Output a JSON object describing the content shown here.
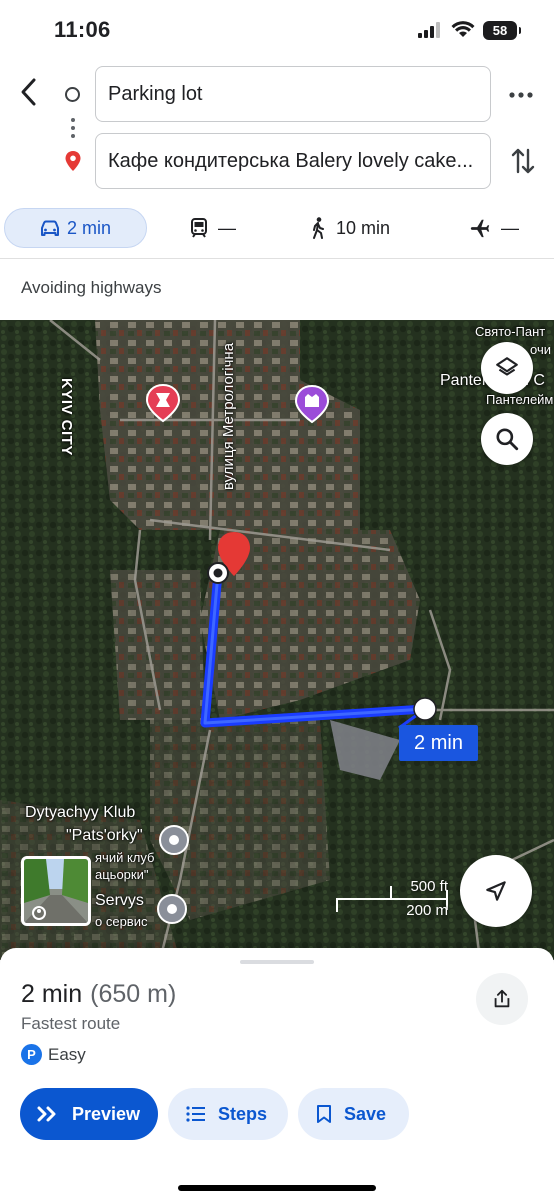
{
  "status_bar": {
    "time": "11:06",
    "battery": "58"
  },
  "directions": {
    "origin": "Parking lot",
    "destination": "Кафе кондитерська Balery lovely cake..."
  },
  "modes": [
    {
      "name": "car-icon",
      "label": "2 min",
      "selected": true
    },
    {
      "name": "transit-icon",
      "label": "—"
    },
    {
      "name": "walk-icon",
      "label": "10 min"
    },
    {
      "name": "flight-icon",
      "label": "—"
    }
  ],
  "route_option": "Avoiding highways",
  "map": {
    "labels": {
      "kyiv_city": "KYIV CITY",
      "street": "вулиця Метрологічна",
      "svyato": "Свято-Пант",
      "svyato2": "очи",
      "panteleimon": "Panteleimon C",
      "panteleimon_ua": "Пантелейм",
      "club_line1": "Dytyachyy Klub",
      "club_line2": "\"Pats'orky\"",
      "club_line3": "ячий клуб",
      "club_line4": "ацьорки\"",
      "servys": "Servys",
      "servys_ua": "о сервис"
    },
    "route_time": "2 min",
    "scale_ft": "500 ft",
    "scale_m": "200 m"
  },
  "sheet": {
    "duration": "2 min",
    "distance": "(650 m)",
    "subtitle": "Fastest route",
    "parking_badge": "P",
    "parking": "Easy",
    "buttons": {
      "preview": "Preview",
      "steps": "Steps",
      "save": "Save"
    }
  },
  "colors": {
    "accent": "#0b57d0",
    "route": "#1a3cff",
    "pin": "#e53935"
  }
}
